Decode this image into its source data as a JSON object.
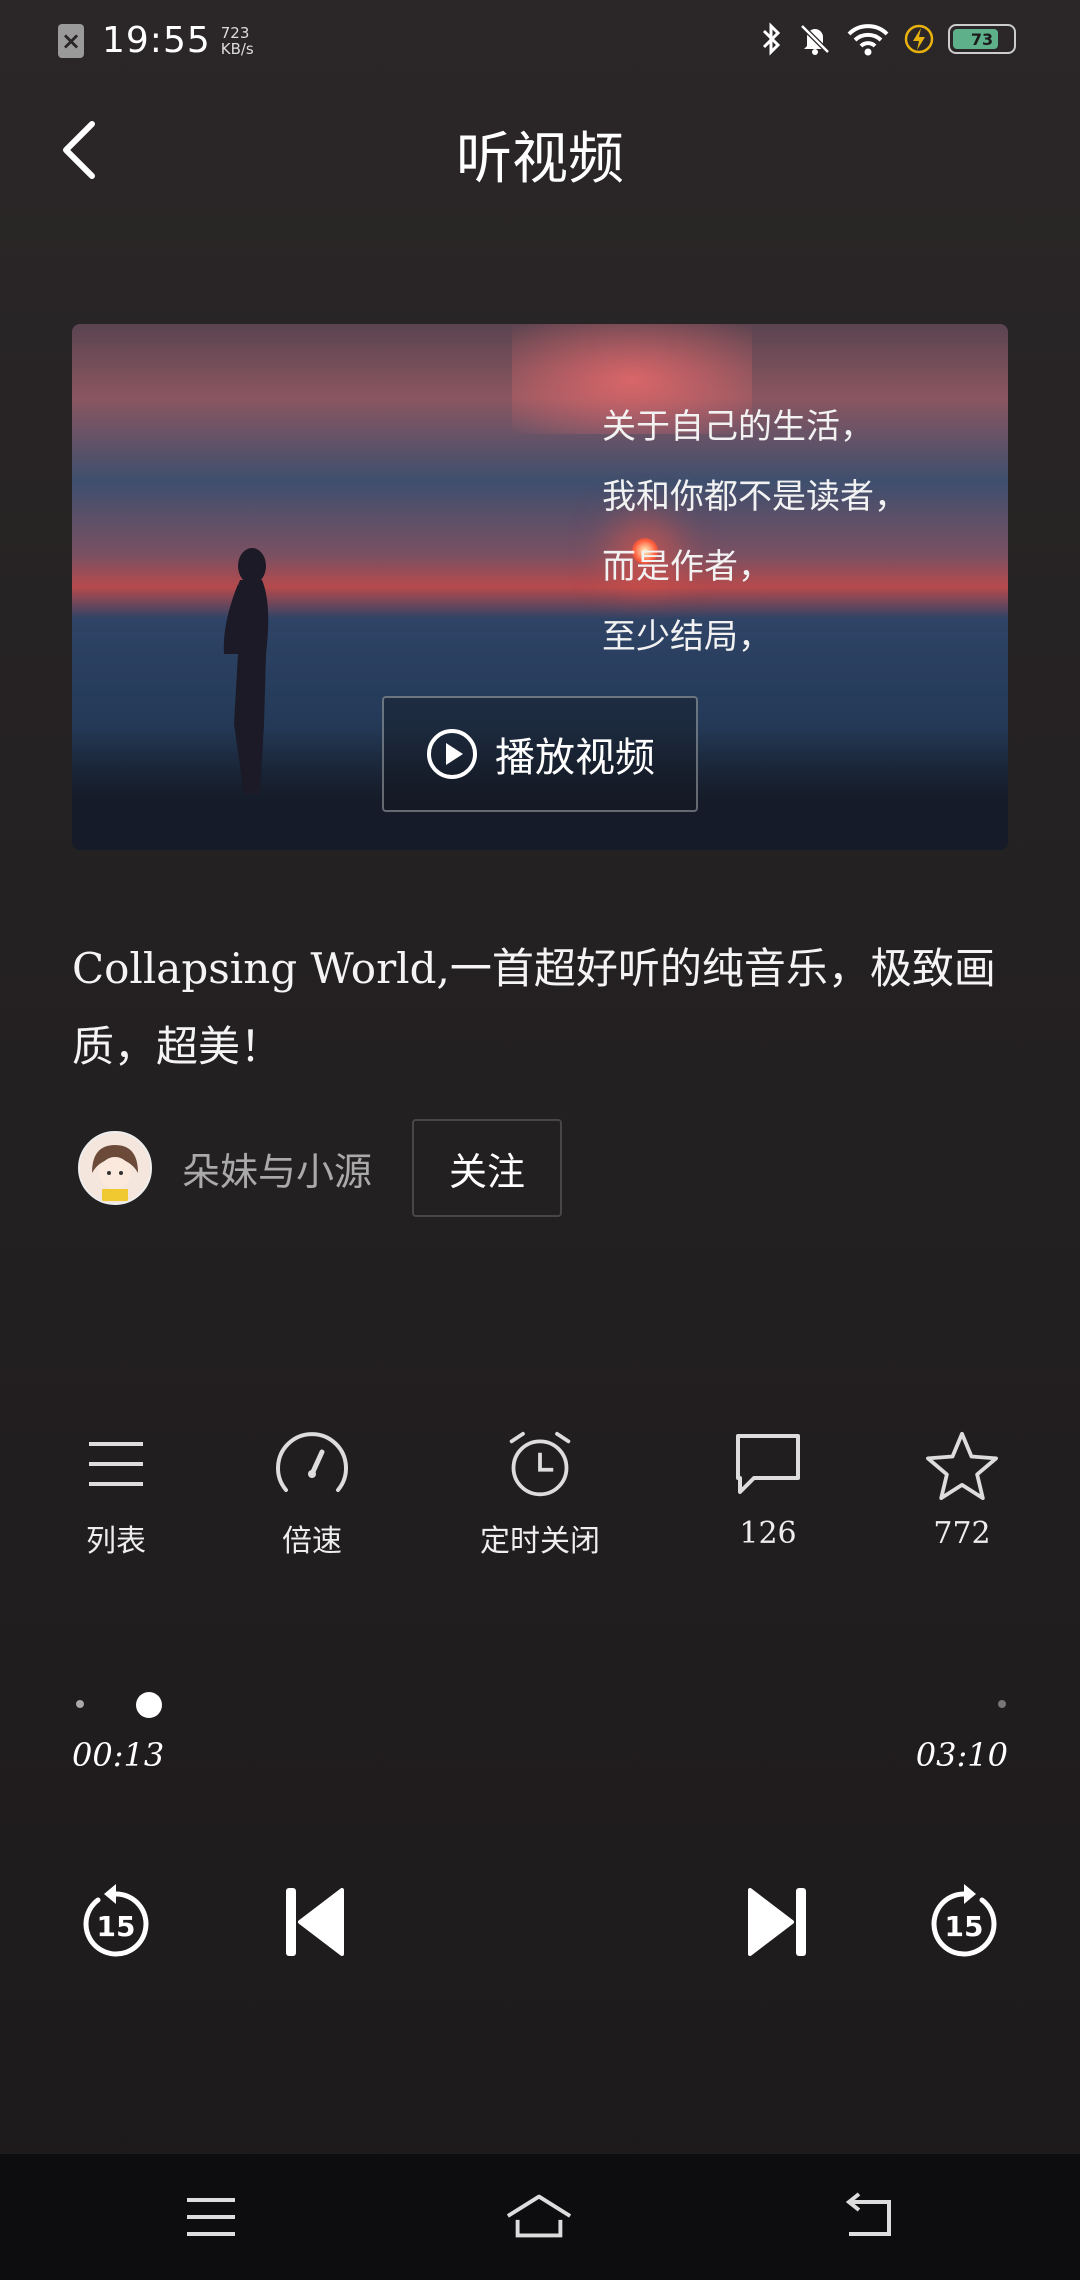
{
  "status_bar": {
    "time": "19:55",
    "net_speed_value": "723",
    "net_speed_unit": "KB/s",
    "battery": "73"
  },
  "header": {
    "title": "听视频"
  },
  "video": {
    "poem_lines": [
      "关于自己的生活，",
      "我和你都不是读者，",
      "而是作者，",
      "至少结局，"
    ],
    "play_label": "播放视频"
  },
  "description": "Collapsing World,一首超好听的纯音乐，极致画质，超美！",
  "author": {
    "name": "朵妹与小源",
    "follow_label": "关注"
  },
  "actions": {
    "list": "列表",
    "speed": "倍速",
    "timer": "定时关闭",
    "comments": "126",
    "favorites": "772"
  },
  "progress": {
    "current": "00:13",
    "total": "03:10",
    "fraction": 0.07
  },
  "controls": {
    "rewind_seconds": "15",
    "forward_seconds": "15"
  }
}
